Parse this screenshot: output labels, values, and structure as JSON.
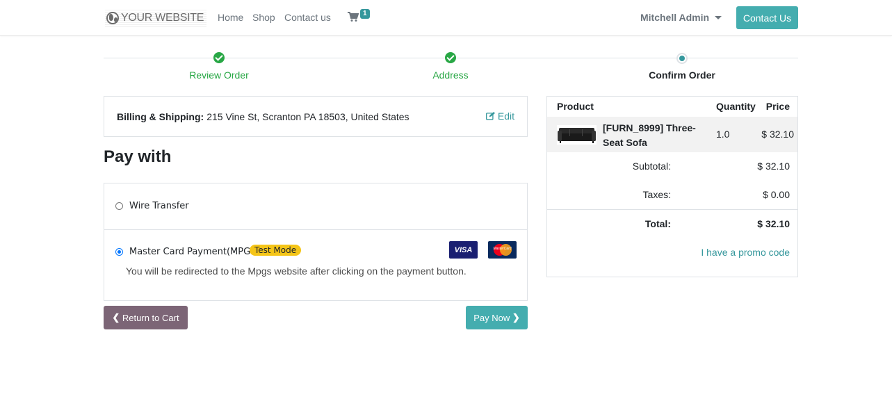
{
  "header": {
    "logo_text": "YOUR WEBSITE",
    "nav": [
      "Home",
      "Shop",
      "Contact us"
    ],
    "cart_count": "1",
    "user_name": "Mitchell Admin",
    "contact_button": "Contact Us"
  },
  "steps": [
    {
      "label": "Review Order",
      "state": "done"
    },
    {
      "label": "Address",
      "state": "done"
    },
    {
      "label": "Confirm Order",
      "state": "current"
    }
  ],
  "billing": {
    "label": "Billing & Shipping:",
    "address": "215 Vine St, Scranton PA 18503, United States",
    "edit_label": "Edit"
  },
  "payment": {
    "title": "Pay with",
    "methods": [
      {
        "label": "Wire Transfer",
        "selected": false
      },
      {
        "label": "Master Card Payment(MPGS)",
        "selected": true,
        "badge": "Test Mode",
        "description": "You will be redirected to the Mpgs website after clicking on the payment button."
      }
    ],
    "card_icons": [
      "visa-icon",
      "mastercard-icon"
    ],
    "visa_text": "VISA",
    "mc_text": "MasterCard"
  },
  "buttons": {
    "return": "Return to Cart",
    "pay": "Pay Now"
  },
  "summary": {
    "headers": {
      "product": "Product",
      "quantity": "Quantity",
      "price": "Price"
    },
    "items": [
      {
        "name": "[FURN_8999] Three-Seat Sofa",
        "quantity": "1.0",
        "price": "$ 32.10"
      }
    ],
    "subtotal_label": "Subtotal:",
    "subtotal": "$ 32.10",
    "taxes_label": "Taxes:",
    "taxes": "$ 0.00",
    "total_label": "Total:",
    "total": "$ 32.10",
    "promo": "I have a promo code"
  },
  "colors": {
    "primary": "#44adaf",
    "success": "#28a745",
    "secondary": "#7c6576",
    "badge": "#f5c518"
  }
}
